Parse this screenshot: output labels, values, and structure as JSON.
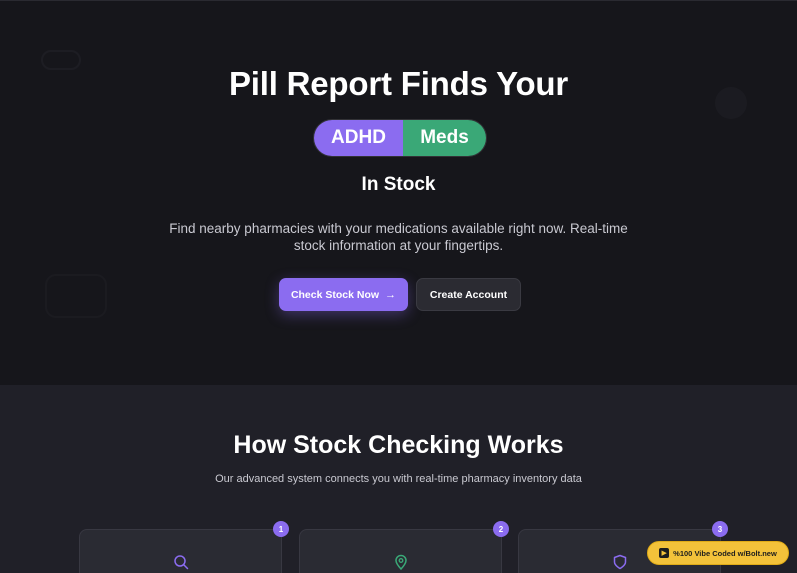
{
  "hero": {
    "title": "Pill Report Finds Your",
    "pill_left": "ADHD",
    "pill_right": "Meds",
    "subtitle": "In Stock",
    "description": "Find nearby pharmacies with your medications available right now. Real-time stock information at your fingertips.",
    "primary_button": "Check Stock Now",
    "secondary_button": "Create Account"
  },
  "how": {
    "title": "How Stock Checking Works",
    "description": "Our advanced system connects you with real-time pharmacy inventory data",
    "steps": [
      {
        "number": "1",
        "icon": "search-icon"
      },
      {
        "number": "2",
        "icon": "map-pin-icon"
      },
      {
        "number": "3",
        "icon": "shield-icon"
      }
    ]
  },
  "badge": {
    "label": "%100 Vibe Coded w/Bolt.new"
  },
  "colors": {
    "accent": "#8b6cf0",
    "green": "#3aa877",
    "background": "#16161b",
    "section_background": "#202028",
    "badge": "#f3c23a"
  }
}
